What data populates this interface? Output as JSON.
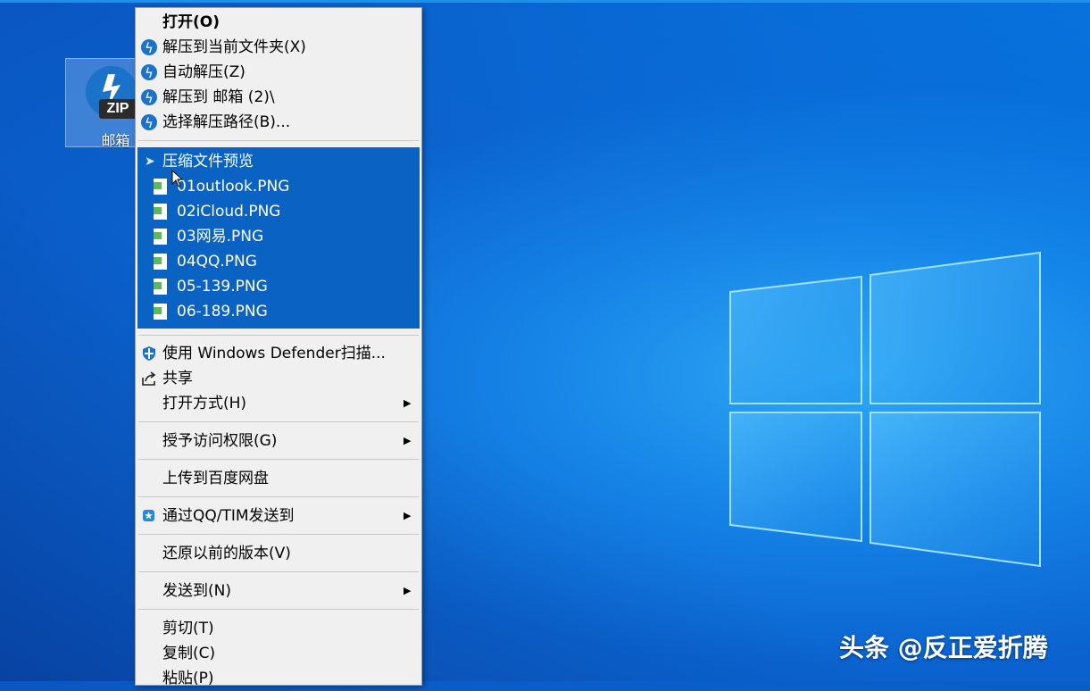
{
  "desktop": {
    "icon_label": "邮箱",
    "icon_badge": "ZIP",
    "background_color": "#0b63cf"
  },
  "context_menu": {
    "open": "打开(O)",
    "extract_here": "解压到当前文件夹(X)",
    "auto_extract": "自动解压(Z)",
    "extract_to": "解压到 邮箱 (2)\\",
    "choose_path": "选择解压路径(B)...",
    "preview_header": "压缩文件预览",
    "preview_files": [
      "01outlook.PNG",
      "02iCloud.PNG",
      "03网易.PNG",
      "04QQ.PNG",
      "05-139.PNG",
      "06-189.PNG"
    ],
    "defender_scan": "使用 Windows Defender扫描...",
    "share": "共享",
    "open_with": "打开方式(H)",
    "grant_access": "授予访问权限(G)",
    "upload_baidu": "上传到百度网盘",
    "send_qq": "通过QQ/TIM发送到",
    "restore_versions": "还原以前的版本(V)",
    "send_to": "发送到(N)",
    "cut": "剪切(T)",
    "copy": "复制(C)",
    "paste": "粘贴(P)",
    "highlight_color": "#0a63c2"
  },
  "watermark": "头条 @反正爱折腾"
}
